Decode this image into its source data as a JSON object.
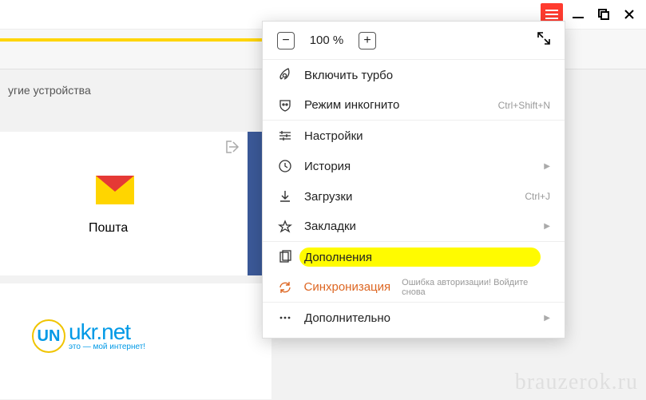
{
  "window": {
    "devices_label": "угие устройства",
    "watermark": "brauzerok.ru"
  },
  "card_mail": {
    "label": "Пошта"
  },
  "ukrnet": {
    "logo_letters": "UN",
    "name": "ukr.net",
    "tagline": "это — мой интернет!"
  },
  "menu": {
    "zoom": {
      "minus": "−",
      "value": "100 %",
      "plus": "+"
    },
    "turbo": "Включить турбо",
    "incognito": {
      "label": "Режим инкогнито",
      "shortcut": "Ctrl+Shift+N"
    },
    "settings": "Настройки",
    "history": "История",
    "downloads": {
      "label": "Загрузки",
      "shortcut": "Ctrl+J"
    },
    "bookmarks": "Закладки",
    "addons": "Дополнения",
    "sync": {
      "label": "Синхронизация",
      "message": "Ошибка авторизации! Войдите снова"
    },
    "more": "Дополнительно"
  }
}
